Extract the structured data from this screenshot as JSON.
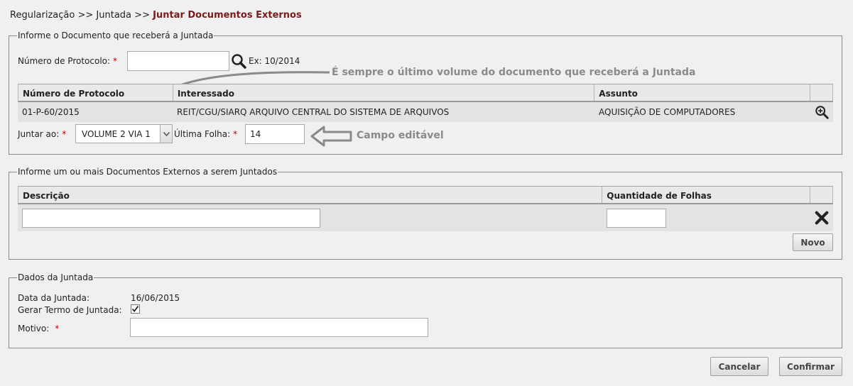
{
  "breadcrumb": {
    "part1": "Regularização",
    "sep1": ">>",
    "part2": "Juntada",
    "sep2": ">>",
    "current": "Juntar Documentos Externos"
  },
  "doc_panel": {
    "legend": "Informe o Documento que receberá a Juntada",
    "protocol_label": "Número de Protocolo:",
    "required_mark": "*",
    "protocol_value": "",
    "protocol_example": "Ex: 10/2014",
    "annotation_volume": "É sempre o último volume do documento que receberá a Juntada",
    "table": {
      "headers": [
        "Número de Protocolo",
        "Interessado",
        "Assunto"
      ],
      "row": {
        "protocol": "01-P-60/2015",
        "interessado": "REIT/CGU/SIARQ ARQUIVO CENTRAL DO SISTEMA DE ARQUIVOS",
        "assunto": "AQUISIÇÃO DE COMPUTADORES"
      }
    },
    "juntar_label": "Juntar ao:",
    "juntar_value": "VOLUME 2 VIA 1",
    "ultima_folha_label": "Última Folha:",
    "ultima_folha_value": "14",
    "annotation_editable": "Campo editável"
  },
  "ext_panel": {
    "legend": "Informe um ou mais Documentos Externos a serem Juntados",
    "headers": [
      "Descrição",
      "Quantidade de Folhas"
    ],
    "descricao_value": "",
    "quantidade_value": "",
    "novo_label": "Novo"
  },
  "dados_panel": {
    "legend": "Dados da Juntada",
    "data_label": "Data da Juntada:",
    "data_value": "16/06/2015",
    "gerar_label": "Gerar Termo de Juntada:",
    "gerar_checked": true,
    "motivo_label": "Motivo:",
    "motivo_value": ""
  },
  "footer": {
    "cancel_label": "Cancelar",
    "confirm_label": "Confirmar"
  },
  "colors": {
    "breadcrumb_current": "#7a1a1a",
    "required": "#bb0000",
    "annotation": "#8a8a8a"
  }
}
